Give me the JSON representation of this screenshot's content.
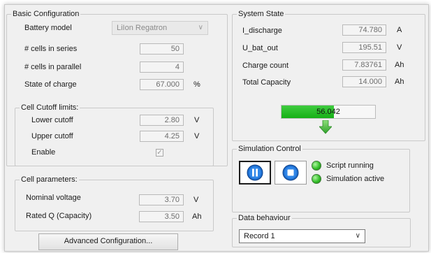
{
  "basic": {
    "title": "Basic Configuration",
    "battery_model_label": "Battery model",
    "battery_model_value": "LiIon Regatron",
    "cells_series_label": "# cells in series",
    "cells_series_value": "50",
    "cells_parallel_label": "# cells in parallel",
    "cells_parallel_value": "4",
    "soc_label": "State of charge",
    "soc_value": "67.000",
    "soc_unit": "%"
  },
  "cutoff": {
    "title": "Cell Cutoff limits:",
    "lower_label": "Lower cutoff",
    "lower_value": "2.80",
    "lower_unit": "V",
    "upper_label": "Upper cutoff",
    "upper_value": "4.25",
    "upper_unit": "V",
    "enable_label": "Enable",
    "enable_checked": true
  },
  "cellparams": {
    "title": "Cell parameters:",
    "nominal_label": "Nominal voltage",
    "nominal_value": "3.70",
    "nominal_unit": "V",
    "rated_label": "Rated Q (Capacity)",
    "rated_value": "3.50",
    "rated_unit": "Ah"
  },
  "advanced_button": "Advanced Configuration...",
  "state": {
    "title": "System State",
    "i_label": "I_discharge",
    "i_value": "74.780",
    "i_unit": "A",
    "u_label": "U_bat_out",
    "u_value": "195.51",
    "u_unit": "V",
    "count_label": "Charge count",
    "count_value": "7.83761",
    "count_unit": "Ah",
    "cap_label": "Total Capacity",
    "cap_value": "14.000",
    "cap_unit": "Ah",
    "progress_text": "56.042",
    "progress_fraction": 0.56042
  },
  "sim": {
    "title": "Simulation Control",
    "script_label": "Script running",
    "sim_label": "Simulation active"
  },
  "data": {
    "title": "Data behaviour",
    "selected": "Record 1"
  },
  "colors": {
    "accent_green": "#16b016",
    "button_blue": "#1a73d9"
  }
}
